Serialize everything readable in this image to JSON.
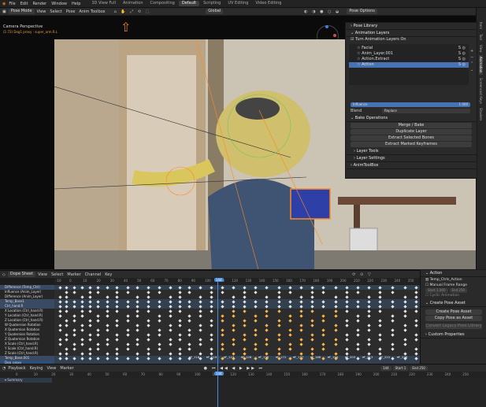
{
  "top_menu": [
    "File",
    "Edit",
    "Render",
    "Window",
    "Help"
  ],
  "workspaces": [
    "3D View Full",
    "Animation",
    "Compositing",
    "Default",
    "Scripting",
    "UV Editing",
    "Video Editing"
  ],
  "active_workspace": "Default",
  "viewport_header": {
    "mode": "Pose Mode",
    "menus": [
      "View",
      "Select",
      "Pose",
      "Anim Toolbox"
    ],
    "shading": "Global",
    "options": "Pose Options"
  },
  "viewport": {
    "camera_title": "Camera Perspective",
    "camera_subtitle": "(1:72) Dog1 proxy : super_arm.R.L"
  },
  "side_tabs": [
    "Item",
    "Tool",
    "View",
    "Animation",
    "Screencast Keys",
    "Shaders"
  ],
  "npanel": {
    "pose_library": "Pose Library",
    "anim_layers": "Animation Layers",
    "turn_on": "Turn Animation Layers On",
    "layers": [
      "Facial",
      "Anim_Layer.001",
      "Action.Extract",
      "Action"
    ],
    "selected_layer_index": 3,
    "influence_label": "Influence",
    "influence_value": "1.000",
    "blend_label": "Blend",
    "blend_value": "Replace",
    "bake_ops": "Bake Operations",
    "merge": "Merge / Bake",
    "duplicate": "Duplicate Layer",
    "extract_bones": "Extract Selected Bones",
    "extract_keys": "Extract Marked Keyframes",
    "layer_tools": "Layer Tools",
    "layer_settings": "Layer Settings",
    "anim_toolbox": "AnimToolBox"
  },
  "dopesheet": {
    "mode": "Dope Sheet",
    "menus": [
      "View",
      "Select",
      "Marker",
      "Channel",
      "Key"
    ],
    "ruler": [
      "-10",
      "0",
      "10",
      "20",
      "30",
      "40",
      "50",
      "60",
      "70",
      "80",
      "90",
      "100",
      "110",
      "120",
      "130",
      "140",
      "150",
      "160",
      "170",
      "180",
      "190",
      "200",
      "210",
      "220",
      "230",
      "240",
      "250"
    ],
    "playhead": "144",
    "channels": [
      {
        "label": "Difference (Temp_Ctrl)",
        "type": "grp"
      },
      {
        "label": "Influence (Anim_Layer)",
        "type": "ch"
      },
      {
        "label": "Difference (Anim_Layer)",
        "type": "ch"
      },
      {
        "label": "Temp_Base1",
        "type": "grp"
      },
      {
        "label": "Ctrl_hand.R",
        "type": "grp"
      },
      {
        "label": "X Location (Ctrl_hand.R)",
        "type": "ch"
      },
      {
        "label": "Y Location (Ctrl_hand.R)",
        "type": "ch"
      },
      {
        "label": "Z Location (Ctrl_hand.R)",
        "type": "ch"
      },
      {
        "label": "W Quaternion Rotation",
        "type": "ch"
      },
      {
        "label": "X Quaternion Rotation",
        "type": "ch"
      },
      {
        "label": "Y Quaternion Rotation",
        "type": "ch"
      },
      {
        "label": "Z Quaternion Rotation",
        "type": "ch"
      },
      {
        "label": "X Scale (Ctrl_hand.R)",
        "type": "ch"
      },
      {
        "label": "Y Scale (Ctrl_hand.R)",
        "type": "ch"
      },
      {
        "label": "Z Scale (Ctrl_hand.R)",
        "type": "ch"
      },
      {
        "label": "Temp_Base.001",
        "type": "grp"
      },
      {
        "label": "Dog_proxy",
        "type": "obj"
      },
      {
        "label": "Dog1Action",
        "type": "obj"
      },
      {
        "label": "Object Transforms",
        "type": "ch"
      }
    ],
    "markers": [
      "F_118",
      "F_119",
      "F_121",
      "F_126",
      "F_136",
      "F_172",
      "F_177",
      "F_186",
      "F_194",
      "F_203",
      "F_213",
      "F_222",
      "F_226"
    ]
  },
  "action_panel": {
    "title": "Action",
    "action_name": "Temp_Ctrls_Action",
    "manual_range": "Manual Frame Range",
    "start_label": "Start",
    "start_value": "1.000",
    "end_label": "End",
    "end_value": "250",
    "cyclic": "Cyclic Animation",
    "create_pose": "Create Pose Asset",
    "create_pose_btn": "Create Pose Asset",
    "copy_pose": "Copy Pose as Asset",
    "convert": "Convert Legacy Pose Library",
    "custom_props": "Custom Properties"
  },
  "timeline": {
    "menus": [
      "Playback",
      "Keying",
      "View",
      "Marker"
    ],
    "frame": "144",
    "start_label": "Start",
    "start": "1",
    "end_label": "End",
    "end": "250",
    "ruler": [
      "0",
      "10",
      "20",
      "30",
      "40",
      "50",
      "60",
      "70",
      "80",
      "90",
      "100",
      "110",
      "120",
      "130",
      "140",
      "150",
      "160",
      "170",
      "180",
      "190",
      "200",
      "210",
      "220",
      "230",
      "240",
      "250"
    ],
    "summary": "Summary"
  }
}
